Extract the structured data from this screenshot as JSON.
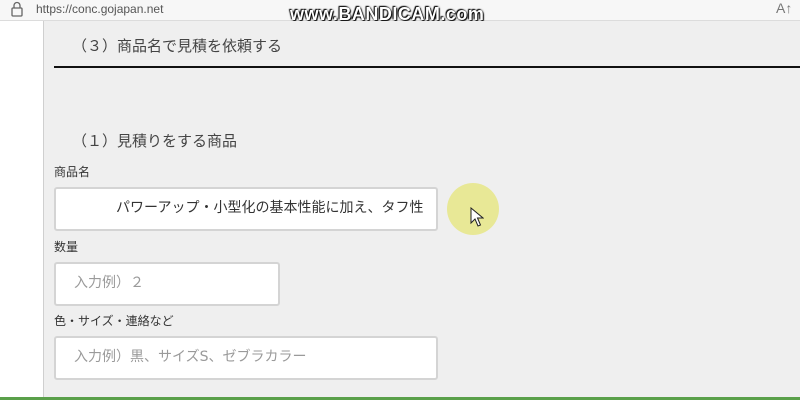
{
  "browser": {
    "url": "https://conc.gojapan.net",
    "watermark": "www.BANDICAM.com",
    "read_aloud_label": "A↑"
  },
  "page": {
    "section_title": "（３）商品名で見積を依頼する",
    "subsection_title": "（１）見積りをする商品",
    "fields": {
      "product_name": {
        "label": "商品名",
        "value": "パワーアップ・小型化の基本性能に加え、タフ性"
      },
      "quantity": {
        "label": "数量",
        "placeholder": "入力例）２"
      },
      "options": {
        "label": "色・サイズ・連絡など",
        "placeholder": "入力例）黒、サイズS、ゼブラカラー"
      }
    }
  }
}
